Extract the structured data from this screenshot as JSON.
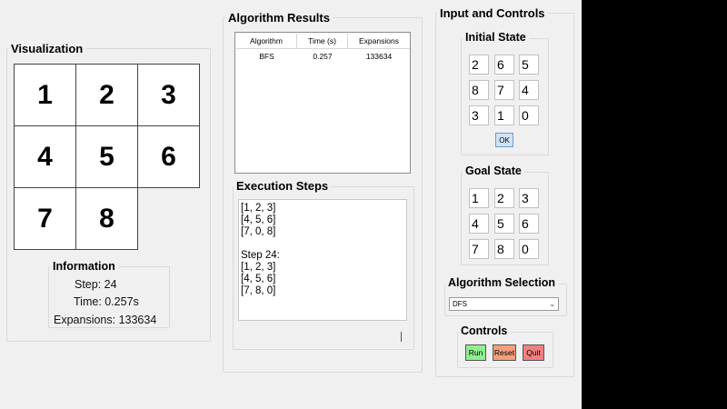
{
  "visualization": {
    "title": "Visualization",
    "tiles": [
      "1",
      "2",
      "3",
      "4",
      "5",
      "6",
      "7",
      "8",
      ""
    ]
  },
  "information": {
    "title": "Information",
    "step": "Step: 24",
    "time": "Time: 0.257s",
    "expansions": "Expansions: 133634"
  },
  "results": {
    "title": "Algorithm Results",
    "columns": [
      "Algorithm",
      "Time (s)",
      "Expansions"
    ],
    "rows": [
      [
        "BFS",
        "0.257",
        "133634"
      ]
    ]
  },
  "execution": {
    "title": "Execution Steps",
    "lines": [
      "[1, 2, 3]",
      "[4, 5, 6]",
      "[7, 0, 8]",
      "",
      "Step 24:",
      "[1, 2, 3]",
      "[4, 5, 6]",
      "[7, 8, 0]"
    ]
  },
  "input": {
    "title": "Input and Controls",
    "initial_title": "Initial State",
    "initial": [
      "2",
      "6",
      "5",
      "8",
      "7",
      "4",
      "3",
      "1",
      "0"
    ],
    "ok_label": "OK",
    "goal_title": "Goal State",
    "goal": [
      "1",
      "2",
      "3",
      "4",
      "5",
      "6",
      "7",
      "8",
      "0"
    ]
  },
  "algorithm_selection": {
    "title": "Algorithm Selection",
    "selected": "DFS"
  },
  "controls": {
    "title": "Controls",
    "run_label": "Run",
    "reset_label": "Reset",
    "quit_label": "Quit"
  },
  "colors": {
    "run": "#90ee90",
    "reset": "#f4a07c",
    "quit": "#f08080"
  }
}
